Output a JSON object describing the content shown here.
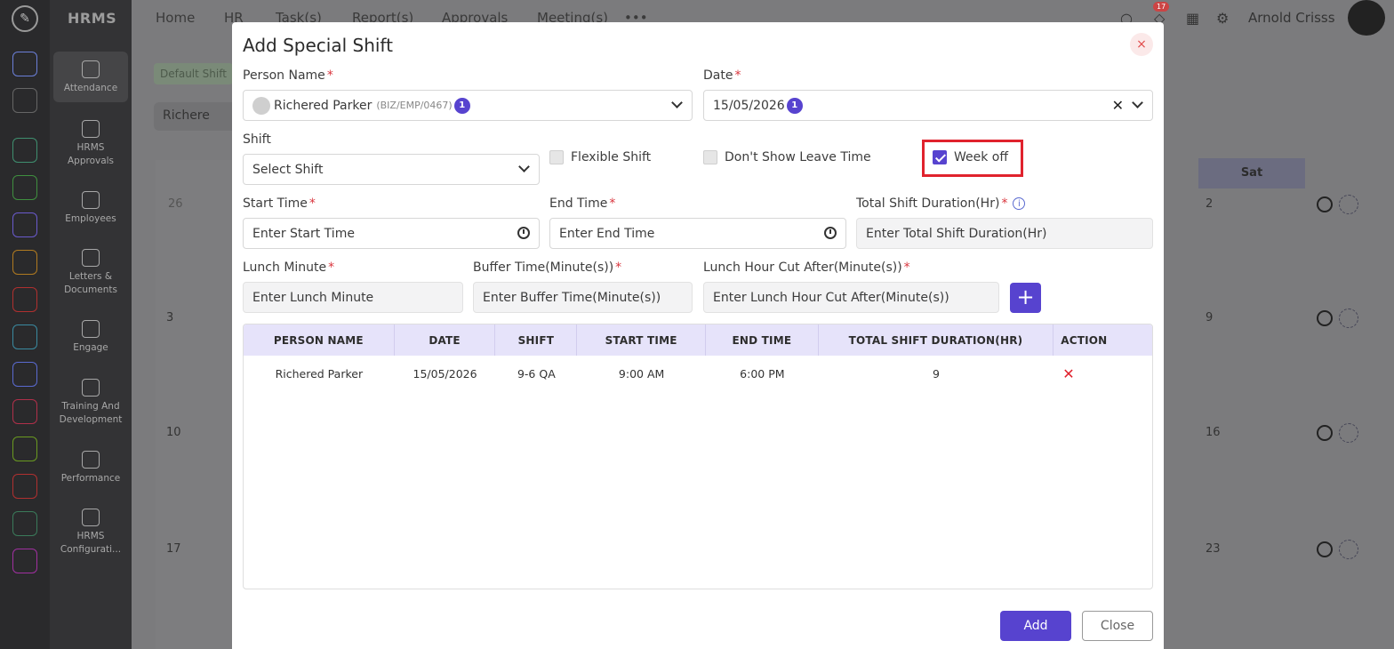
{
  "app": {
    "name": "HRMS",
    "user": "Arnold Crisss",
    "notification_count": "17"
  },
  "top_menu": [
    "Home",
    "HR",
    "Task(s)",
    "Report(s)",
    "Approvals",
    "Meeting(s)"
  ],
  "nav_items": [
    "Attendance",
    "HRMS Approvals",
    "Employees",
    "Letters & Documents",
    "Engage",
    "Training And Development",
    "Performance",
    "HRMS Configurati..."
  ],
  "background": {
    "default_shift_tab": "Default Shift",
    "person_pill": "Richere",
    "sat_header": "Sat",
    "dates_left": [
      "26",
      "3",
      "10",
      "17"
    ],
    "dates_right": [
      "2",
      "9",
      "16",
      "23"
    ]
  },
  "modal": {
    "title": "Add Special Shift",
    "close_icon": "×",
    "person_label": "Person Name",
    "person_value": "Richered Parker",
    "person_code": "(BIZ/EMP/0467)",
    "person_badge": "1",
    "date_label": "Date",
    "date_value": "15/05/2026",
    "date_badge": "1",
    "shift_label": "Shift",
    "shift_value": "Select Shift",
    "flexible_label": "Flexible Shift",
    "dont_show_leave_label": "Don't Show Leave Time",
    "week_off_label": "Week off",
    "week_off_checked": true,
    "start_label": "Start Time",
    "start_placeholder": "Enter Start Time",
    "end_label": "End Time",
    "end_placeholder": "Enter End Time",
    "duration_label": "Total Shift Duration(Hr)",
    "duration_placeholder": "Enter Total Shift Duration(Hr)",
    "lunch_label": "Lunch Minute",
    "lunch_placeholder": "Enter Lunch Minute",
    "buffer_label": "Buffer Time(Minute(s))",
    "buffer_placeholder": "Enter Buffer Time(Minute(s))",
    "lunch_cut_label": "Lunch Hour Cut After(Minute(s))",
    "lunch_cut_placeholder": "Enter Lunch Hour Cut After(Minute(s))",
    "required_mark": "*",
    "table": {
      "headers": [
        "PERSON NAME",
        "DATE",
        "SHIFT",
        "START TIME",
        "END TIME",
        "TOTAL SHIFT DURATION(HR)",
        "ACTION"
      ],
      "rows": [
        {
          "person": "Richered Parker",
          "date": "15/05/2026",
          "shift": "9-6 QA",
          "start": "9:00 AM",
          "end": "6:00 PM",
          "duration": "9",
          "action": "✕"
        }
      ]
    },
    "add_button": "Add",
    "close_button": "Close"
  }
}
